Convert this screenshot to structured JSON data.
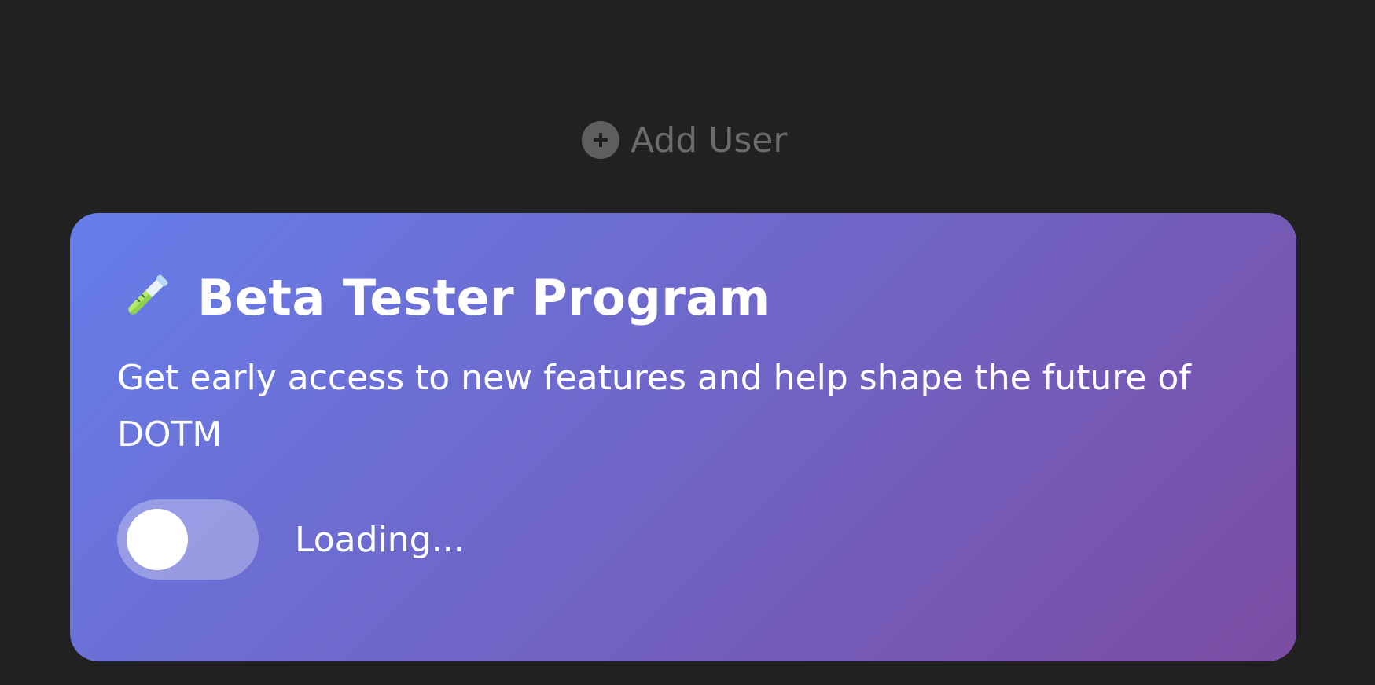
{
  "add_user": {
    "label": "Add User",
    "icon": "plus-circle-icon"
  },
  "beta": {
    "icon": "test-tube-icon",
    "title": "Beta Tester Program",
    "description": "Get early access to new features and help shape the future of DOTM",
    "toggle_enabled": false,
    "status": "Loading..."
  },
  "colors": {
    "background": "#212121",
    "card_gradient_start": "#667eea",
    "card_gradient_end": "#7a4ca2",
    "muted_text": "#6b6b6b"
  }
}
